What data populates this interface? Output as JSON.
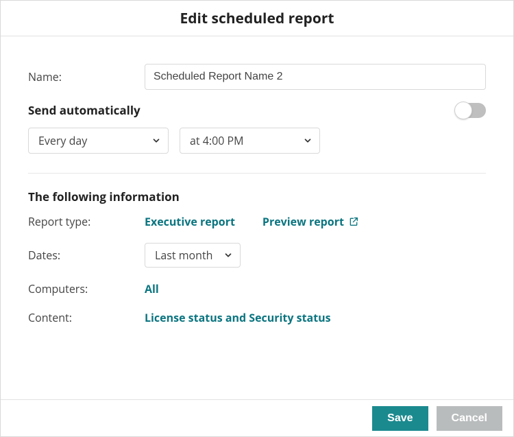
{
  "title": "Edit scheduled report",
  "name_label": "Name:",
  "name_value": "Scheduled Report Name 2",
  "send_auto_label": "Send automatically",
  "send_auto_on": false,
  "frequency_value": "Every day",
  "time_value": "at 4:00 PM",
  "info_section_title": "The following information",
  "report_type_label": "Report type:",
  "report_type_value": "Executive report",
  "preview_label": "Preview report",
  "dates_label": "Dates:",
  "dates_value": "Last month",
  "computers_label": "Computers:",
  "computers_value": "All",
  "content_label": "Content:",
  "content_value": "License status and Security status",
  "footer": {
    "save": "Save",
    "cancel": "Cancel"
  }
}
